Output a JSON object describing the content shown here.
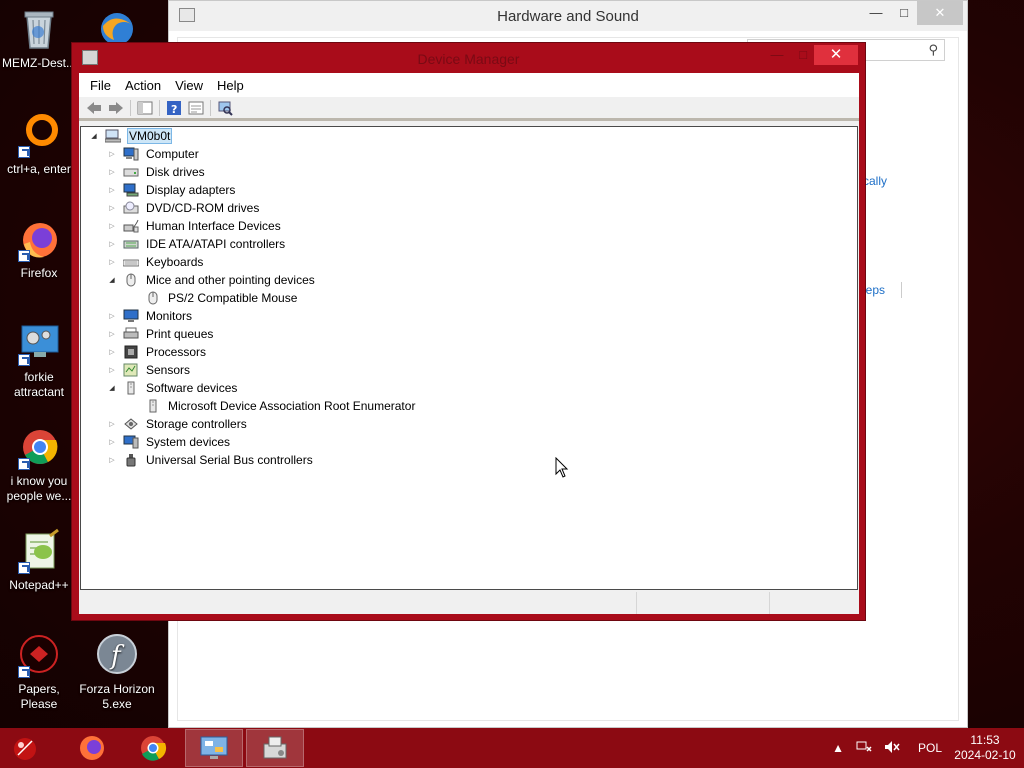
{
  "desktop": {
    "icons": [
      {
        "label": "MEMZ-Dest..."
      },
      {
        "label": ""
      },
      {
        "label": "ctrl+a, enter"
      },
      {
        "label": "Firefox"
      },
      {
        "label": "forkie attractant"
      },
      {
        "label": "i know you people we..."
      },
      {
        "label": "Notepad++"
      },
      {
        "label": "Papers, Please"
      },
      {
        "label": "Forza Horizon 5.exe"
      }
    ]
  },
  "hw_window": {
    "title": "Hardware and Sound",
    "search_icon": "search-icon",
    "link_1": "tically",
    "link_2": "eeps"
  },
  "device_manager": {
    "title": "Device Manager",
    "close_glyph": "✕",
    "menu": [
      "File",
      "Action",
      "View",
      "Help"
    ],
    "root": "VM0b0t",
    "nodes": [
      {
        "label": "Computer",
        "expanded": false
      },
      {
        "label": "Disk drives",
        "expanded": false
      },
      {
        "label": "Display adapters",
        "expanded": false
      },
      {
        "label": "DVD/CD-ROM drives",
        "expanded": false
      },
      {
        "label": "Human Interface Devices",
        "expanded": false
      },
      {
        "label": "IDE ATA/ATAPI controllers",
        "expanded": false
      },
      {
        "label": "Keyboards",
        "expanded": false
      },
      {
        "label": "Mice and other pointing devices",
        "expanded": true
      },
      {
        "label": "PS/2 Compatible Mouse",
        "child": true
      },
      {
        "label": "Monitors",
        "expanded": false
      },
      {
        "label": "Print queues",
        "expanded": false
      },
      {
        "label": "Processors",
        "expanded": false
      },
      {
        "label": "Sensors",
        "expanded": false
      },
      {
        "label": "Software devices",
        "expanded": true
      },
      {
        "label": "Microsoft Device Association Root Enumerator",
        "child": true
      },
      {
        "label": "Storage controllers",
        "expanded": false
      },
      {
        "label": "System devices",
        "expanded": false
      },
      {
        "label": "Universal Serial Bus controllers",
        "expanded": false
      }
    ]
  },
  "taskbar": {
    "language": "POL",
    "time": "11:53",
    "date": "2024-02-10"
  },
  "colors": {
    "desktop_bg": "#220303",
    "dm_frame": "#a90c1a",
    "taskbar": "#8c0a12",
    "close_button": "#e0303d",
    "link": "#1e6fc7"
  }
}
